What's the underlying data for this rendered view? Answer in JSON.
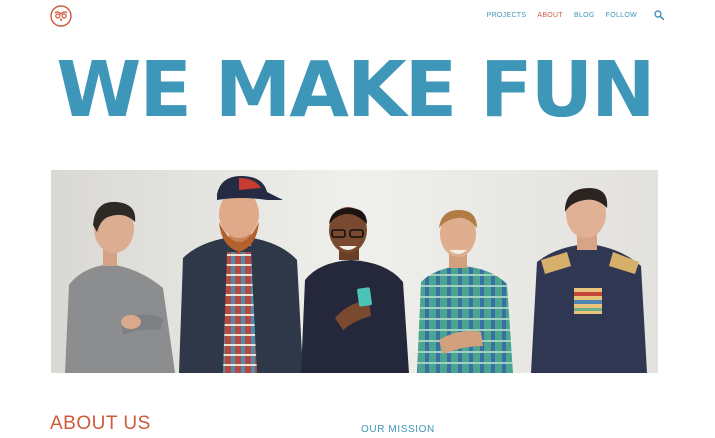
{
  "colors": {
    "brand_blue": "#3e97b8",
    "accent_orange": "#cf5a3a",
    "background": "#ffffff"
  },
  "header": {
    "logo_icon": "owl-face-icon",
    "nav": [
      {
        "label": "PROJECTS",
        "active": false
      },
      {
        "label": "ABOUT",
        "active": true
      },
      {
        "label": "BLOG",
        "active": false
      },
      {
        "label": "FOLLOW",
        "active": false
      }
    ],
    "search_icon": "search-icon"
  },
  "hero": {
    "title": "WE MAKE FUN"
  },
  "team_photo": {
    "people": 5
  },
  "sections": {
    "about_heading": "ABOUT US",
    "mission_heading": "OUR MISSION"
  }
}
